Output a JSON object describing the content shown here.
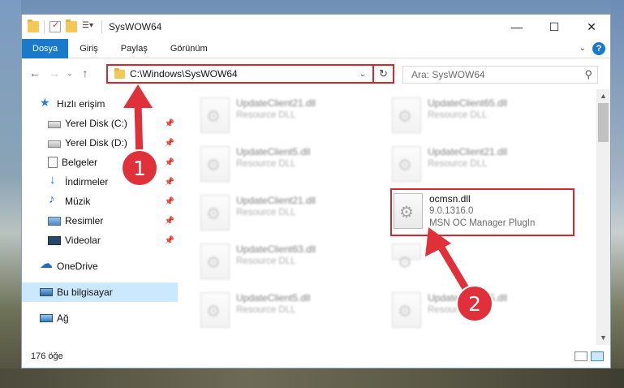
{
  "window": {
    "title": "SysWOW64",
    "minimize_glyph": "—",
    "maximize_glyph": "☐",
    "close_glyph": "✕"
  },
  "ribbon": {
    "tabs": [
      "Dosya",
      "Giriş",
      "Paylaş",
      "Görünüm"
    ]
  },
  "navigation": {
    "back_glyph": "←",
    "forward_glyph": "→",
    "recent_glyph": "⌄",
    "up_glyph": "↑",
    "address": "C:\\Windows\\SysWOW64",
    "search_placeholder": "Ara: SysWOW64"
  },
  "sidebar": {
    "quick_access": "Hızlı erişim",
    "items": [
      {
        "label": "Yerel Disk (C:)",
        "icon": "drive-icon",
        "pinned": true
      },
      {
        "label": "Yerel Disk (D:)",
        "icon": "drive-icon",
        "pinned": true
      },
      {
        "label": "Belgeler",
        "icon": "documents-icon",
        "pinned": true
      },
      {
        "label": "İndirmeler",
        "icon": "downloads-icon",
        "pinned": true
      },
      {
        "label": "Müzik",
        "icon": "music-icon",
        "pinned": true
      },
      {
        "label": "Resimler",
        "icon": "pictures-icon",
        "pinned": true
      },
      {
        "label": "Videolar",
        "icon": "videos-icon",
        "pinned": true
      }
    ],
    "onedrive": "OneDrive",
    "this_pc": "Bu bilgisayar",
    "network": "Ağ"
  },
  "files": [
    {
      "name": "UpdateClient21.dll",
      "type": "Resource DLL"
    },
    {
      "name": "UpdateClient65.dll",
      "type": "Resource DLL"
    },
    {
      "name": "UpdateClient5.dll",
      "type": "Resource DLL"
    },
    {
      "name": "UpdateClient21.dll",
      "type": "Resource DLL"
    },
    {
      "name": "UpdateClient21.dll",
      "type": "Resource DLL"
    },
    {
      "name": "UpdateClient63.dll",
      "type": "Resource DLL"
    },
    {
      "name": "UpdateClient5.dll",
      "type": "Resource DLL"
    },
    {
      "name": "UpdateClient65.dll",
      "type": "Resource DLL"
    }
  ],
  "highlighted_file": {
    "name": "ocmsn.dll",
    "version": "9.0.1316.0",
    "description": "MSN OC Manager PlugIn"
  },
  "status": {
    "item_count": "176 öğe"
  },
  "annotations": {
    "step1": "1",
    "step2": "2",
    "color": "#d9262e"
  }
}
